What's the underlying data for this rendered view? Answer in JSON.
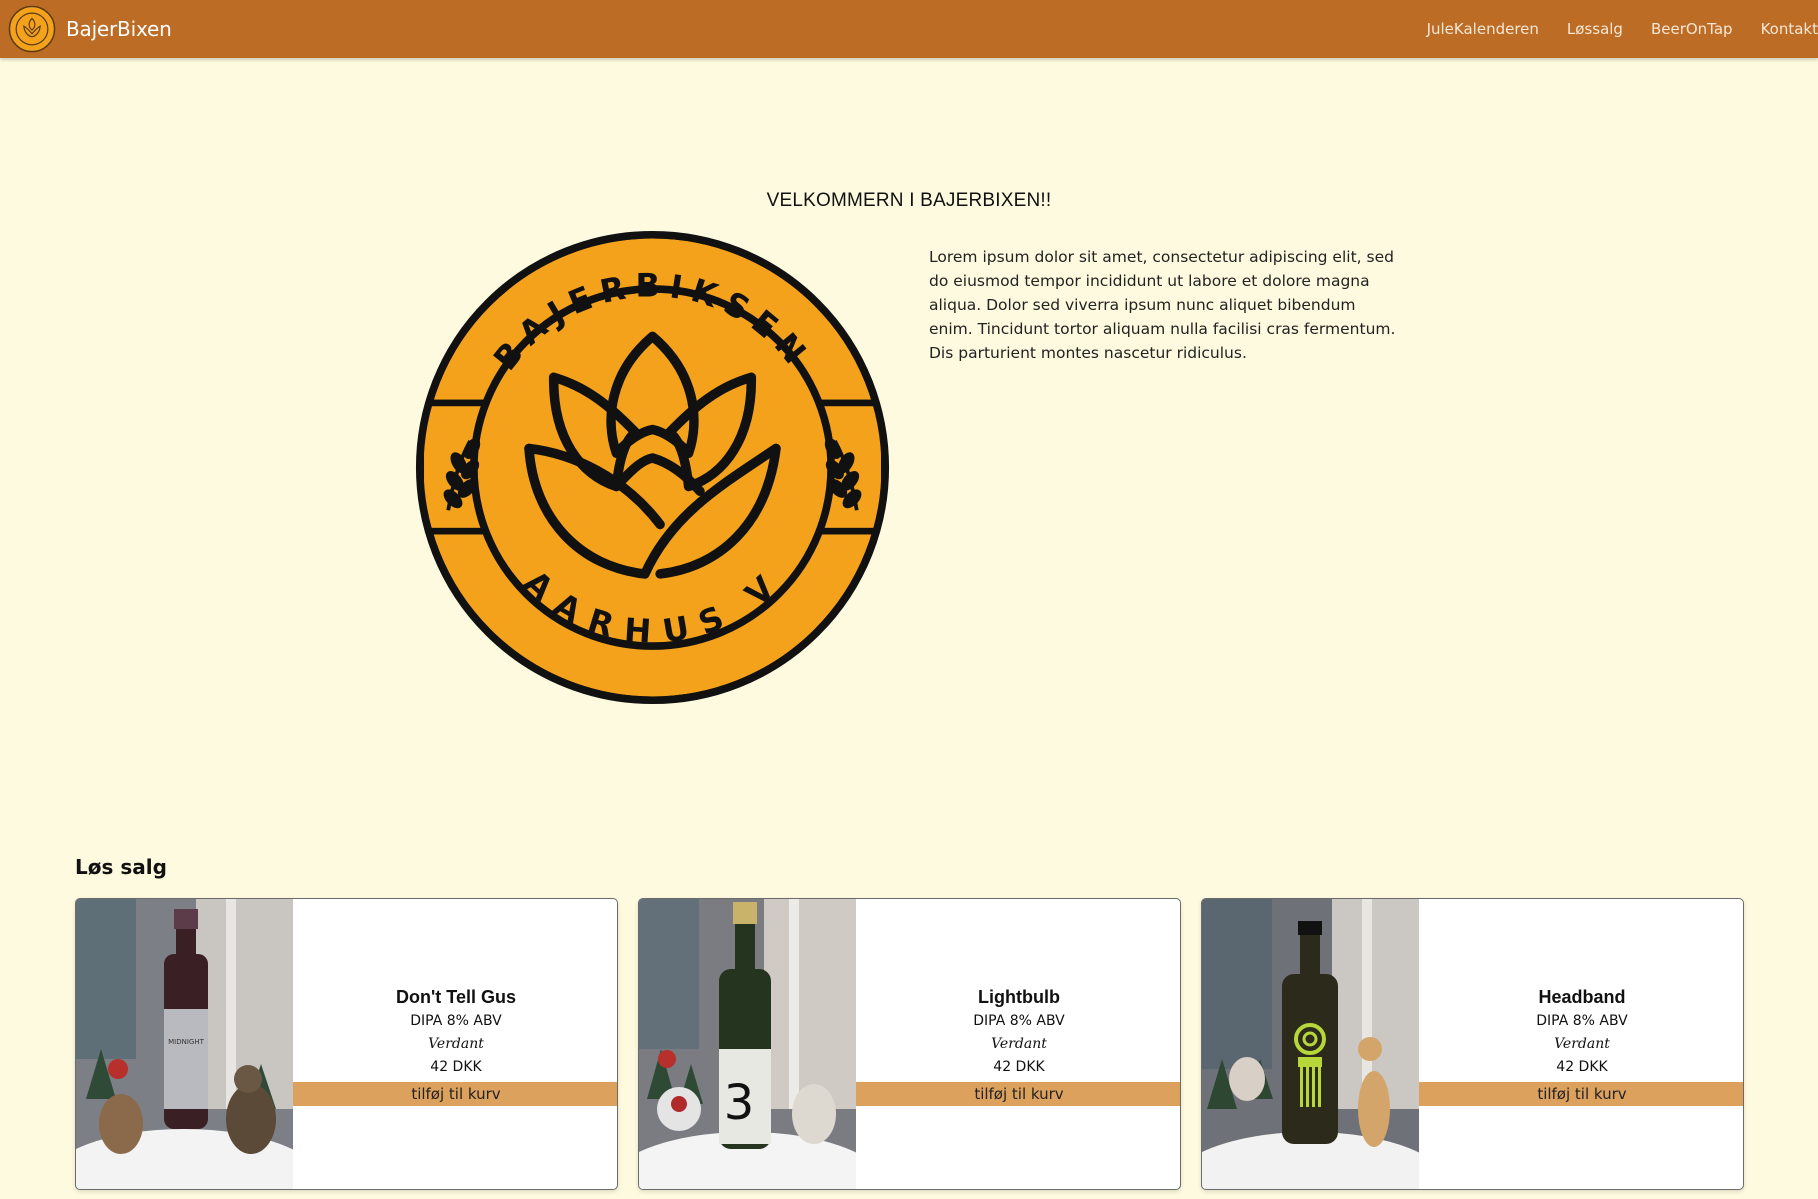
{
  "navbar": {
    "brand": "BajerBixen",
    "links": [
      "JuleKalenderen",
      "Løssalg",
      "BeerOnTap",
      "Kontakt"
    ]
  },
  "hero": {
    "title": "VELKOMMERN I BAJERBIXEN!!",
    "text": "Lorem ipsum dolor sit amet, consectetur adipiscing elit, sed do eiusmod tempor incididunt ut labore et dolore magna aliqua. Dolor sed viverra ipsum nunc aliquet bibendum enim. Tincidunt tortor aliquam nulla facilisi cras fermentum. Dis parturient montes nascetur ridiculus.",
    "logo_top_text": "BAJERBIKSEN",
    "logo_bottom_text": "AARHUS V"
  },
  "section": {
    "heading": "Løs salg"
  },
  "products": [
    {
      "name": "Don't Tell Gus",
      "style": "DIPA 8% ABV",
      "brewery": "Verdant",
      "price": "42 DKK",
      "button": "tilføj til kurv",
      "bottle_color": "#3a1f24",
      "label_color": "#b9b9c0"
    },
    {
      "name": "Lightbulb",
      "style": "DIPA 8% ABV",
      "brewery": "Verdant",
      "price": "42 DKK",
      "button": "tilføj til kurv",
      "bottle_color": "#24341f",
      "label_color": "#e8e8e2"
    },
    {
      "name": "Headband",
      "style": "DIPA 8% ABV",
      "brewery": "Verdant",
      "price": "42 DKK",
      "button": "tilføj til kurv",
      "bottle_color": "#2b2a1b",
      "label_color": "#b6d63a"
    }
  ],
  "colors": {
    "navbar": "#bc6c25",
    "background": "#fefadf",
    "button": "#dda15e",
    "logo_fill": "#f4a21c",
    "logo_stroke": "#111111"
  }
}
